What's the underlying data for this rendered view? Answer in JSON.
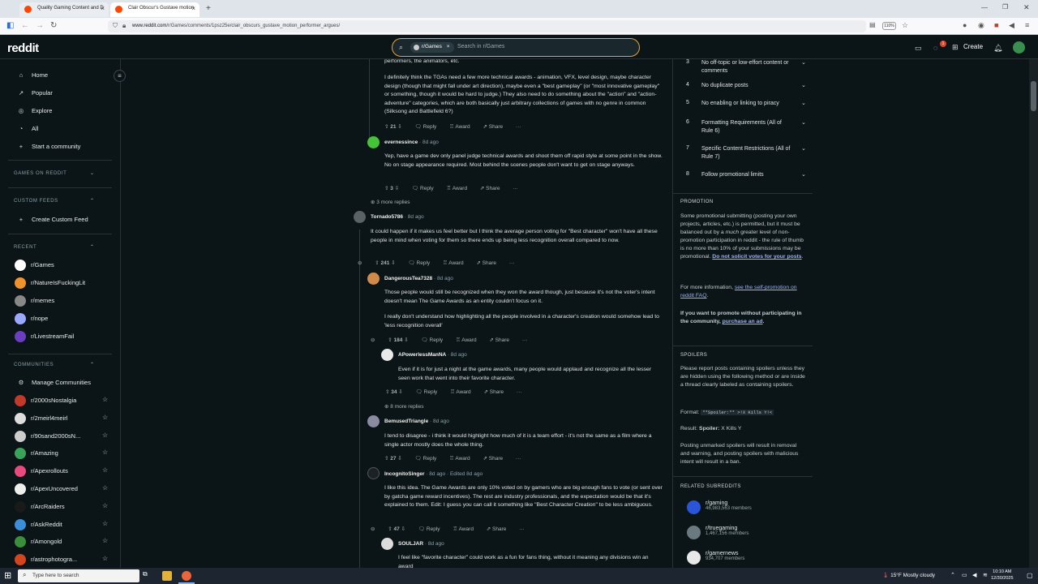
{
  "browser": {
    "tabs": [
      {
        "title": "Quality Gaming Content and D",
        "active": false
      },
      {
        "title": "Clair Obscur's Gustave motion",
        "active": true
      }
    ],
    "url_domain": "www.reddit.com",
    "url_path": "/r/Games/comments/1psz25e/clair_obscurs_gustave_motion_performer_argues/",
    "zoom": "110%"
  },
  "header": {
    "logo": "reddit",
    "search_chip": "r/Games",
    "search_placeholder": "Search in r/Games",
    "create_label": "Create",
    "notification_count": "1"
  },
  "left_nav": {
    "top_items": [
      {
        "icon": "home-icon",
        "label": "Home"
      },
      {
        "icon": "popular-icon",
        "label": "Popular"
      },
      {
        "icon": "explore-icon",
        "label": "Explore"
      },
      {
        "icon": "all-icon",
        "label": "All"
      },
      {
        "icon": "plus-icon",
        "label": "Start a community"
      }
    ],
    "games_heading": "GAMES ON REDDIT",
    "custom_feeds_heading": "CUSTOM FEEDS",
    "create_custom_feed": "Create Custom Feed",
    "recent_heading": "RECENT",
    "recent": [
      {
        "name": "r/Games",
        "color": "#ffffff"
      },
      {
        "name": "r/NatureIsFuckingLit",
        "color": "#f0922b"
      },
      {
        "name": "r/memes",
        "color": "#888888"
      },
      {
        "name": "r/nope",
        "color": "#9aa9ff"
      },
      {
        "name": "r/LivestreamFail",
        "color": "#6a3fbf"
      }
    ],
    "communities_heading": "COMMUNITIES",
    "manage_communities": "Manage Communities",
    "communities": [
      {
        "name": "r/2000sNostalgia",
        "color": "#c0392b"
      },
      {
        "name": "r/2meirl4meirl",
        "color": "#dddddd"
      },
      {
        "name": "r/90sand2000sN...",
        "color": "#cccccc"
      },
      {
        "name": "r/Amazing",
        "color": "#3aa35a"
      },
      {
        "name": "r/Apexrollouts",
        "color": "#e84a7f"
      },
      {
        "name": "r/ApexUncovered",
        "color": "#eeeeee"
      },
      {
        "name": "r/ArcRaiders",
        "color": "#1a1a1a"
      },
      {
        "name": "r/AskReddit",
        "color": "#3b8ed8"
      },
      {
        "name": "r/Amongold",
        "color": "#3a8f3a"
      },
      {
        "name": "r/astrophotogra...",
        "color": "#d2451e"
      }
    ]
  },
  "comments": {
    "c0": {
      "body1": "performers, the animators, etc.",
      "body2": "I definitely think the TGAs need a few more technical awards - animation, VFX, level design, maybe character design (though that might fall under art direction), maybe even a \"best gameplay\" (or \"most innovative gameplay\" or something, though it would be hard to judge.) They also need to do something about the \"action\" and \"action-adventure\" categories, which are both basically just arbitrary collections of games with no genre in common (Silksong and Battlefield 6?)",
      "votes": "21"
    },
    "c1": {
      "author": "evernessince",
      "time": "8d ago",
      "body": "Yep, have a game dev only panel judge technical awards and shoot them off rapid style at some point in the show. No on stage appearance required. Most behind the scenes people don't want to get on stage anyways.",
      "votes": "3"
    },
    "more1": "3 more replies",
    "c2": {
      "author": "Tornado5786",
      "time": "8d ago",
      "body": "It could happen if it makes us feel better but I think the average person voting for \"Best character\" won't have all these people in mind when voting for them so there ends up being less recognition overall compared to now.",
      "votes": "241"
    },
    "c3": {
      "author": "DangerousTea7328",
      "time": "8d ago",
      "body1": "Those people would still be recognized when they won the award though, just because it's not the voter's intent doesn't mean The Game Awards as an entity couldn't focus on it.",
      "body2": "I really don't understand how highlighting all the people involved in a character's creation would somehow lead to 'less recognition overall'",
      "votes": "184"
    },
    "c4": {
      "author": "APowerlessManNA",
      "time": "8d ago",
      "body": "Even if it is for just a night at the game awards, many people would applaud and recognize all the lesser seen work that went into their favorite character.",
      "votes": "34"
    },
    "more2": "8 more replies",
    "c5": {
      "author": "BemusedTriangle",
      "time": "8d ago",
      "body": "I tend to disagree - i think it would highlight how much of it is a team effort - it's not the same as a film where a single actor mostly does the whole thing.",
      "votes": "27"
    },
    "c6": {
      "author": "IncognitoSinger",
      "time": "8d ago · Edited 8d ago",
      "body": "I like this idea. The Game Awards are only 10% voted on by gamers who are big enough fans to vote (or sent over by gatcha game reward incentives). The rest are industry professionals, and the expectation would be that it's explained to them. Edit: I guess you can call it something like \"Best Character Creation\" to be less ambiguous.",
      "votes": "47"
    },
    "c7": {
      "author": "SOULJAR",
      "time": "8d ago",
      "body": "I feel like \"favorite character\" could work as a fun for fans thing, without it meaning any divisions win an award"
    },
    "reply": "Reply",
    "award": "Award",
    "share": "Share"
  },
  "sidebar": {
    "rules": [
      {
        "n": "3",
        "text": "No off-topic or low-effort content or comments"
      },
      {
        "n": "4",
        "text": "No duplicate posts"
      },
      {
        "n": "5",
        "text": "No enabling or linking to piracy"
      },
      {
        "n": "6",
        "text": "Formatting Requirements (All of Rule 6)"
      },
      {
        "n": "7",
        "text": "Specific Content Restrictions (All of Rule 7)"
      },
      {
        "n": "8",
        "text": "Follow promotional limits"
      }
    ],
    "promotion_heading": "PROMOTION",
    "promo_p1": "Some promotional submitting (posting your own projects, articles, etc.) is permitted, but it must be balanced out by a",
    "promo_p1_em": "much",
    "promo_p1b": "greater level of non-promotion participation in reddit - the rule of thumb is no more than 10% of your submissions may be promotional.",
    "promo_link1": "Do not solicit votes for your posts",
    "promo_p2": "For more information,",
    "promo_link2": "see the self-promotion on reddit FAQ",
    "promo_p3": "If you want to promote without participating in the community,",
    "promo_link3": "purchase an ad",
    "spoilers_heading": "SPOILERS",
    "spoiler_p1": "Please report posts containing spoilers unless they are hidden using the following method or are inside a thread clearly labeled as containing spoilers.",
    "format_label": "Format:",
    "format_code": "**Spoiler:** >!X Kills Y!<",
    "result_label": "Result:",
    "result_bold": "Spoiler:",
    "result_text": "X Kills Y",
    "spoiler_p2": "Posting unmarked spoilers will result in removal and warning, and posting spoilers with malicious intent will result in a ban.",
    "related_heading": "RELATED SUBREDDITS",
    "related": [
      {
        "name": "r/gaming",
        "members": "46,983,563 members",
        "color": "#2a55d8"
      },
      {
        "name": "r/truegaming",
        "members": "1,467,156 members",
        "color": "#6a7a80"
      },
      {
        "name": "r/gamernews",
        "members": "934,707 members",
        "color": "#e8e8e8"
      }
    ]
  },
  "taskbar": {
    "search_placeholder": "Type here to search",
    "weather": "15°F  Mostly cloudy",
    "time": "10:10 AM",
    "date": "12/30/2025"
  }
}
